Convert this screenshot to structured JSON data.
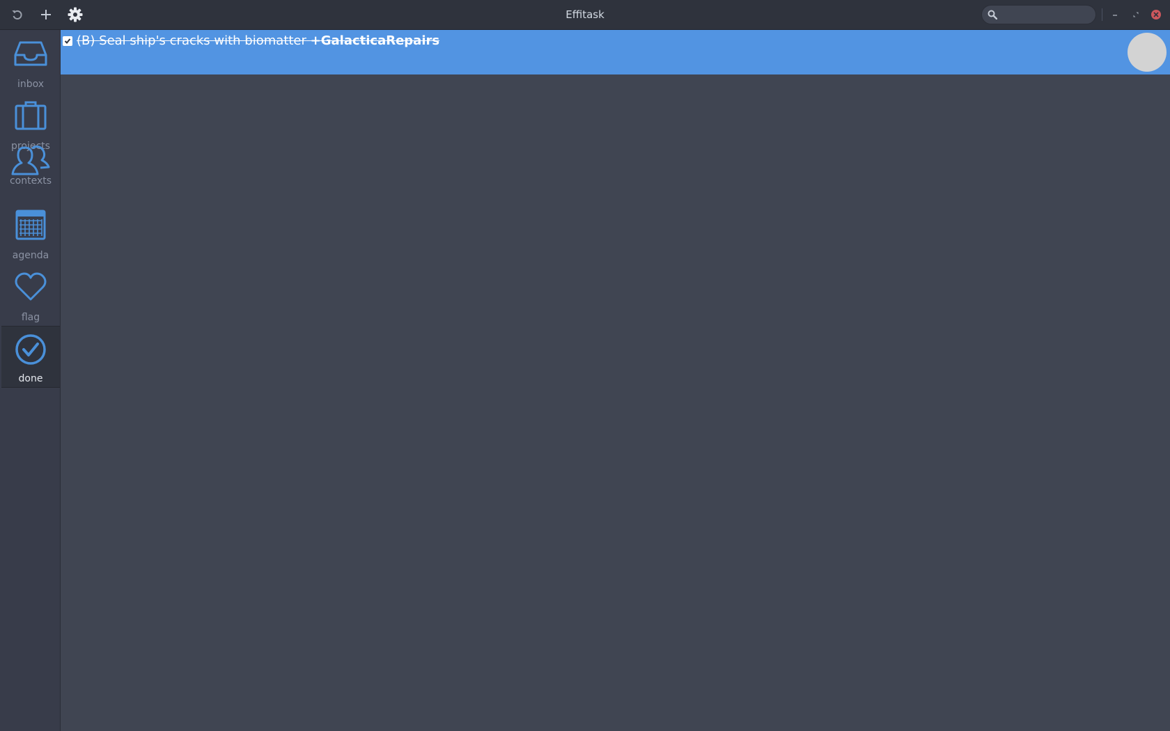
{
  "window": {
    "title": "Effitask"
  },
  "headerbar": {
    "buttons": [
      {
        "id": "refresh",
        "icon": "refresh-icon"
      },
      {
        "id": "add",
        "icon": "plus-icon"
      },
      {
        "id": "settings",
        "icon": "gear-icon"
      }
    ],
    "search": {
      "value": "",
      "placeholder": ""
    }
  },
  "sidebar": {
    "items": [
      {
        "label": "inbox",
        "icon": "inbox-icon",
        "active": false
      },
      {
        "label": "projects",
        "icon": "briefcase-icon",
        "active": false
      },
      {
        "label": "contexts",
        "icon": "people-icon",
        "active": false
      },
      {
        "label": "agenda",
        "icon": "calendar-icon",
        "active": false
      },
      {
        "label": "flag",
        "icon": "heart-icon",
        "active": false
      },
      {
        "label": "done",
        "icon": "check-circle-icon",
        "active": true
      }
    ]
  },
  "tasks": [
    {
      "done": true,
      "priority": "(B)",
      "text": "Seal ship's cracks with biomatter",
      "project": "+GalacticaRepairs"
    }
  ],
  "colors": {
    "accent": "#5294e2",
    "headerbar": "#2f333d",
    "sidebar": "#383c4a",
    "content": "#404552",
    "close": "#cc575d"
  }
}
